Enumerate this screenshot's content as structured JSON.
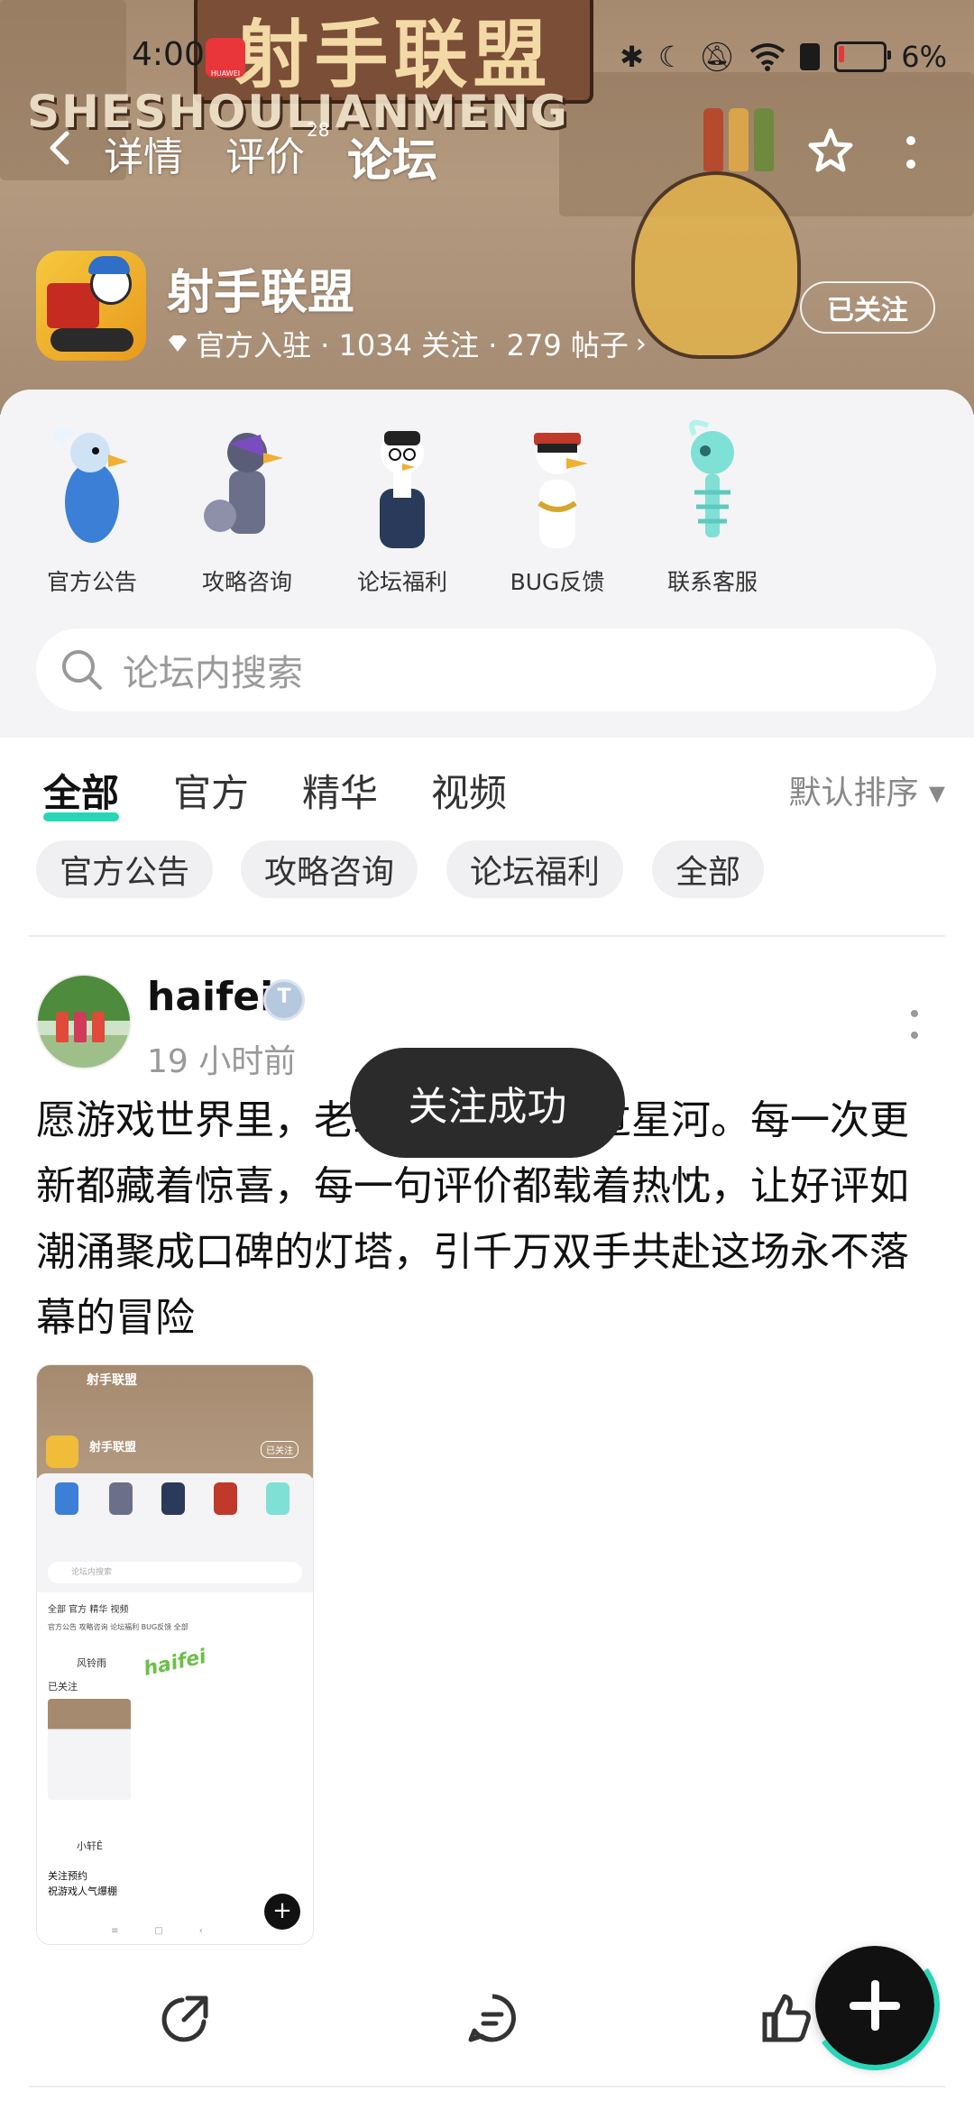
{
  "status_bar": {
    "time": "4:00",
    "carrier": "HUAWEI",
    "battery": "6%"
  },
  "banner": {
    "bg_title": "射手联盟",
    "bg_subtitle": "SHESHOULIANMENG"
  },
  "nav": {
    "tabs": [
      {
        "label": "详情"
      },
      {
        "label": "评价",
        "count": "28"
      },
      {
        "label": "论坛"
      }
    ],
    "icons": [
      "back-icon",
      "star-icon",
      "more-icon"
    ]
  },
  "game": {
    "name": "射手联盟",
    "meta": "官方入驻 · 1034 关注 · 279 帖子",
    "follow_label": "已关注"
  },
  "categories": [
    {
      "label": "官方公告",
      "color": "#3b7fd6"
    },
    {
      "label": "攻略咨询",
      "color": "#6c6f8a"
    },
    {
      "label": "论坛福利",
      "color": "#2a3a5a"
    },
    {
      "label": "BUG反馈",
      "color": "#c0392b"
    },
    {
      "label": "联系客服",
      "color": "#7fe0d6"
    }
  ],
  "search": {
    "placeholder": "论坛内搜索"
  },
  "feed_tabs": [
    {
      "label": "全部"
    },
    {
      "label": "官方"
    },
    {
      "label": "精华"
    },
    {
      "label": "视频"
    }
  ],
  "sort_label": "默认排序 ▾",
  "filter_chips": [
    "官方公告",
    "攻略咨询",
    "论坛福利",
    "全部"
  ],
  "post": {
    "username": "haifei",
    "time": "19 小时前",
    "text": "愿游戏世界里，老玩家的热爱跨过星河。每一次更新都藏着惊喜，每一句评价都载着热忱，让好评如潮涌聚成口碑的灯塔，引千万双手共赴这场永不落幕的冒险",
    "thumbnail": {
      "title": "射手联盟",
      "name": "射手联盟",
      "follow": "已关注",
      "search": "论坛内搜索",
      "tabs": "全部  官方  精华  视频",
      "chips": "官方公告  攻略咨询  论坛福利  BUG反馈  全部",
      "user1": "风铃雨",
      "followed": "已关注",
      "watermark": "haifei",
      "user2": "小轩Ê",
      "fol": "关注预约",
      "rec": "祝游戏人气爆棚"
    }
  },
  "toast": "关注成功",
  "accent_color": "#27d6b6"
}
